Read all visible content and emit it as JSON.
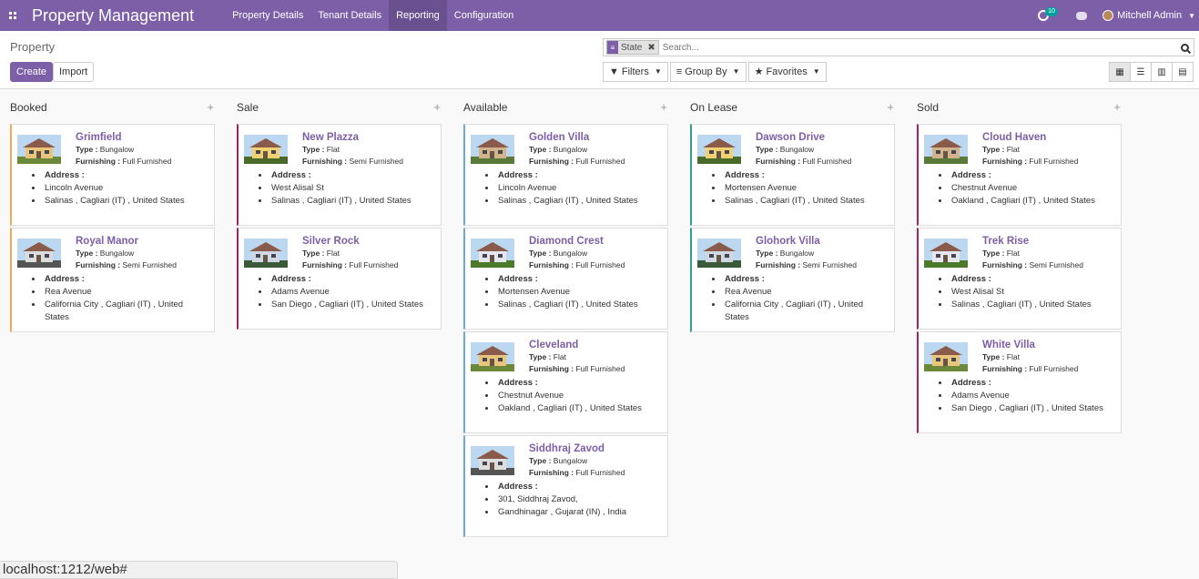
{
  "app": {
    "title": "Property Management",
    "menu": [
      "Property Details",
      "Tenant Details",
      "Reporting",
      "Configuration"
    ],
    "active_menu": "Reporting",
    "activity_count": "10",
    "user": "Mitchell Admin"
  },
  "control": {
    "title": "Property",
    "create": "Create",
    "import": "Import",
    "facet": "State",
    "search_placeholder": "Search...",
    "filters": "Filters",
    "group_by": "Group By",
    "favorites": "Favorites"
  },
  "columns": [
    {
      "name": "Booked",
      "color": "#f0ad4e",
      "cards": [
        {
          "name": "Grimfield",
          "type": "Bungalow",
          "furnishing": "Full Furnished",
          "lines": [
            "Lincoln Avenue",
            "Salinas , Cagliari (IT) , United States"
          ]
        },
        {
          "name": "Royal Manor",
          "type": "Bungalow",
          "furnishing": "Semi Furnished",
          "lines": [
            "Rea Avenue",
            "California City , Cagliari (IT) , United States"
          ]
        }
      ]
    },
    {
      "name": "Sale",
      "color": "#a2245e",
      "cards": [
        {
          "name": "New Plazza",
          "type": "Flat",
          "furnishing": "Semi Furnished",
          "lines": [
            "West Alisal St",
            "Salinas , Cagliari (IT) , United States"
          ]
        },
        {
          "name": "Silver Rock",
          "type": "Flat",
          "furnishing": "Full Furnished",
          "lines": [
            "Adams Avenue",
            "San Diego , Cagliari (IT) , United States"
          ]
        }
      ]
    },
    {
      "name": "Available",
      "color": "#6ea8d8",
      "cards": [
        {
          "name": "Golden Villa",
          "type": "Bungalow",
          "furnishing": "Full Furnished",
          "lines": [
            "Lincoln Avenue",
            "Salinas , Cagliari (IT) , United States"
          ]
        },
        {
          "name": "Diamond Crest",
          "type": "Bungalow",
          "furnishing": "Full Furnished",
          "lines": [
            "Mortensen Avenue",
            "Salinas , Cagliari (IT) , United States"
          ]
        },
        {
          "name": "Cleveland",
          "type": "Flat",
          "furnishing": "Full Furnished",
          "lines": [
            "Chestnut Avenue",
            "Oakland , Cagliari (IT) , United States"
          ]
        },
        {
          "name": "Siddhraj Zavod",
          "type": "Bungalow",
          "furnishing": "Full Furnished",
          "lines": [
            "301, Siddhraj Zavod,",
            "Gandhinagar , Gujarat (IN) , India"
          ]
        }
      ]
    },
    {
      "name": "On Lease",
      "color": "#30a08f",
      "cards": [
        {
          "name": "Dawson Drive",
          "type": "Bungalow",
          "furnishing": "Full Furnished",
          "lines": [
            "Mortensen Avenue",
            "Salinas , Cagliari (IT) , United States"
          ]
        },
        {
          "name": "Glohork Villa",
          "type": "Bungalow",
          "furnishing": "Semi Furnished",
          "lines": [
            "Rea Avenue",
            "California City , Cagliari (IT) , United States"
          ]
        }
      ]
    },
    {
      "name": "Sold",
      "color": "#a2245e",
      "cards": [
        {
          "name": "Cloud Haven",
          "type": "Flat",
          "furnishing": "Full Furnished",
          "lines": [
            "Chestnut Avenue",
            "Oakland , Cagliari (IT) , United States"
          ]
        },
        {
          "name": "Trek Rise",
          "type": "Flat",
          "furnishing": "Semi Furnished",
          "lines": [
            "West Alisal St",
            "Salinas , Cagliari (IT) , United States"
          ]
        },
        {
          "name": "White Villa",
          "type": "Flat",
          "furnishing": "Full Furnished",
          "lines": [
            "Adams Avenue",
            "San Diego , Cagliari (IT) , United States"
          ]
        }
      ]
    }
  ],
  "labels": {
    "type": "Type :",
    "furnishing": "Furnishing :",
    "address": "Address :"
  },
  "status_url": "localhost:1212/web#"
}
